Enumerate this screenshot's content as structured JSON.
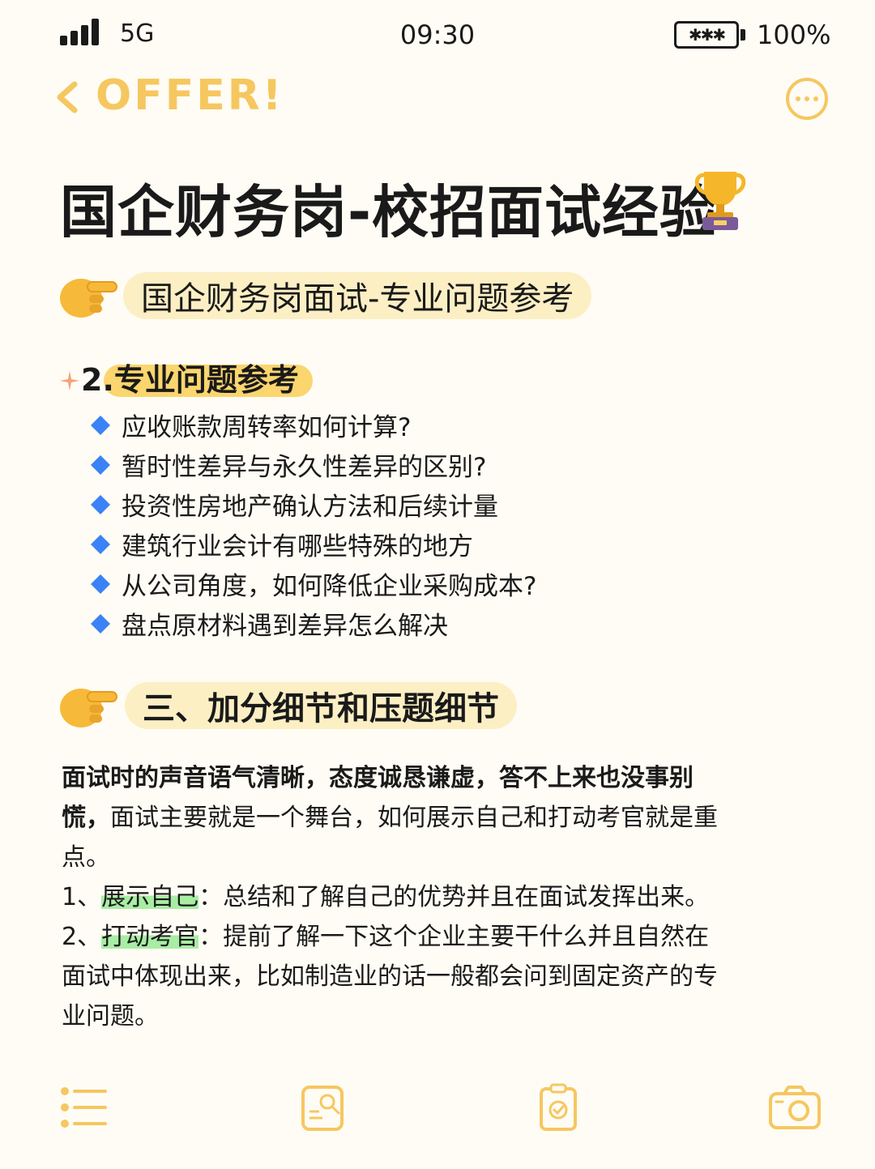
{
  "status_bar": {
    "network": "5G",
    "time": "09:30",
    "battery_percent": "100%"
  },
  "nav": {
    "title": "OFFER!"
  },
  "page": {
    "title": "国企财务岗-校招面试经验"
  },
  "section1": {
    "heading": "国企财务岗面试-专业问题参考",
    "sub_heading": "2.专业问题参考",
    "questions": [
      "应收账款周转率如何计算?",
      "暂时性差异与永久性差异的区别?",
      "投资性房地产确认方法和后续计量",
      "建筑行业会计有哪些特殊的地方",
      "从公司角度，如何降低企业采购成本?",
      "盘点原材料遇到差异怎么解决"
    ]
  },
  "section2": {
    "heading": "三、加分细节和压题细节",
    "intro_bold_1": "面试时的声音语气清晰，态度诚恳谦虚，答不上来也没事别",
    "intro_bold_2": "慌，",
    "intro_rest_2": "面试主要就是一个舞台，如何展示自己和打动考官就是重",
    "intro_rest_3": "点。",
    "point1_num": "1、",
    "point1_key": "展示自己",
    "point1_text": "：总结和了解自己的优势并且在面试发挥出来。",
    "point2_num": "2、",
    "point2_key": "打动考官",
    "point2_text_1": "：提前了解一下这个企业主要干什么并且自然在",
    "point2_text_2": "面试中体现出来，比如制造业的话一般都会问到固定资产的专",
    "point2_text_3": "业问题。"
  },
  "colors": {
    "accent": "#f6c760",
    "pill": "#fcefc4",
    "highlight_yellow": "#fbd56e",
    "highlight_green": "#a8eda4",
    "diamond": "#3b82f6",
    "background": "#fefcf4"
  },
  "toolbar": {
    "icons": [
      "list-icon",
      "search-document-icon",
      "clipboard-check-icon",
      "camera-icon"
    ]
  }
}
